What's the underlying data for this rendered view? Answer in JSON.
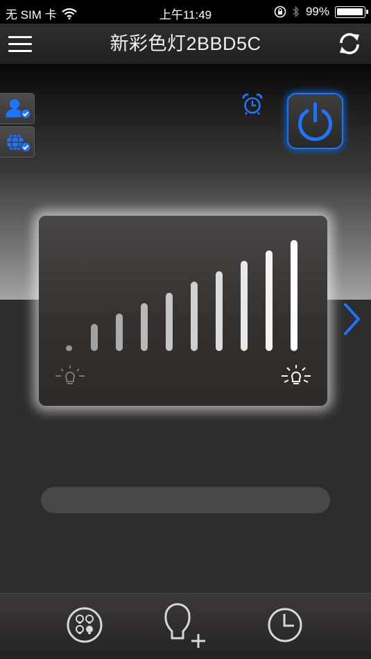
{
  "status_bar": {
    "carrier": "无 SIM 卡",
    "time": "上午11:49",
    "battery": "99%"
  },
  "nav": {
    "title": "新彩色灯2BBD5C",
    "menu_icon": "hamburger-icon",
    "refresh_icon": "refresh-icon"
  },
  "side_buttons": [
    {
      "icon": "user-check-icon"
    },
    {
      "icon": "globe-check-icon"
    }
  ],
  "controls": {
    "alarm_icon": "alarm-clock-icon",
    "power_icon": "power-icon",
    "next_icon": "chevron-right-icon"
  },
  "brightness": {
    "levels": 10,
    "selected_level": 10,
    "dim_icon": "bulb-dim-icon",
    "bright_icon": "bulb-bright-icon"
  },
  "bottom_tabs": [
    {
      "icon": "bulbs-icon"
    },
    {
      "icon": "add-bulb-icon"
    },
    {
      "icon": "clock-icon"
    }
  ],
  "colors": {
    "accent": "#1f74ff",
    "background": "#2e2d2d",
    "bar_active": "#ffffff"
  }
}
